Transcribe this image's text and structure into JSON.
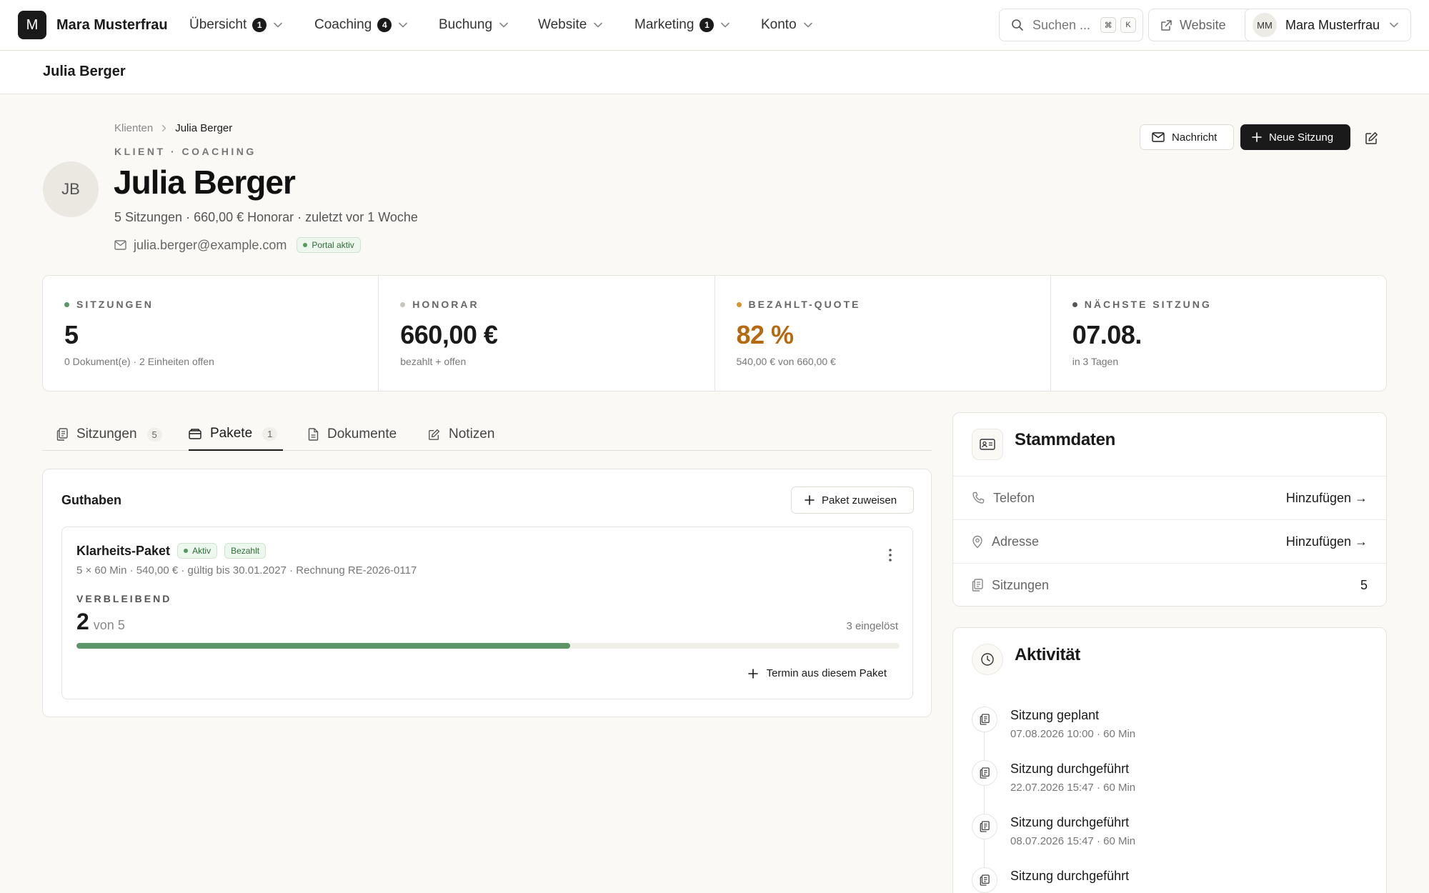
{
  "brand": {
    "logo_letter": "M",
    "name": "Mara Musterfrau"
  },
  "nav": [
    {
      "label": "Übersicht",
      "badge": "1"
    },
    {
      "label": "Coaching",
      "badge": "4"
    },
    {
      "label": "Buchung",
      "badge": ""
    },
    {
      "label": "Website",
      "badge": ""
    },
    {
      "label": "Marketing",
      "badge": "1"
    },
    {
      "label": "Konto",
      "badge": ""
    }
  ],
  "search": {
    "label": "Suchen ...",
    "kbd_mod": "⌘",
    "kbd_key": "K"
  },
  "website_button": "Website",
  "user": {
    "initials": "MM",
    "name": "Mara Musterfrau"
  },
  "subheader": {
    "title": "Julia Berger"
  },
  "breadcrumb": {
    "parent": "Klienten",
    "current": "Julia Berger"
  },
  "profile": {
    "eyebrow": "KLIENT · COACHING",
    "initials": "JB",
    "name": "Julia Berger",
    "summary": "5 Sitzungen · 660,00 € Honorar · zuletzt vor 1 Woche",
    "email": "julia.berger@example.com",
    "portal_badge": "Portal aktiv"
  },
  "actions": {
    "message": "Nachricht",
    "new_session": "Neue Sitzung"
  },
  "stats": [
    {
      "label": "SITZUNGEN",
      "value": "5",
      "sub": "0 Dokument(e) · 2 Einheiten offen",
      "dot_color": "#5b9466"
    },
    {
      "label": "HONORAR",
      "value": "660,00 €",
      "sub": "bezahlt + offen",
      "dot_color": "#c9c6bf"
    },
    {
      "label": "BEZAHLT-QUOTE",
      "value": "82 %",
      "sub": "540,00 € von 660,00 €",
      "dot_color": "#d8952f"
    },
    {
      "label": "NÄCHSTE SITZUNG",
      "value": "07.08.",
      "sub": "in 3 Tagen",
      "dot_color": "#555555"
    }
  ],
  "tabs": [
    {
      "label": "Sitzungen",
      "count": "5"
    },
    {
      "label": "Pakete",
      "count": "1"
    },
    {
      "label": "Dokumente",
      "count": ""
    },
    {
      "label": "Notizen",
      "count": ""
    }
  ],
  "credits": {
    "title": "Guthaben",
    "assign_button": "Paket zuweisen",
    "package": {
      "name": "Klarheits-Paket",
      "status": "Aktiv",
      "payment": "Bezahlt",
      "meta": "5 × 60 Min · 540,00 € · gültig bis 30.01.2027 · Rechnung RE-2026-0117",
      "remaining_label": "VERBLEIBEND",
      "remaining": "2",
      "total_text": "von 5",
      "redeemed": "3 eingelöst",
      "progress_fraction": 0.6,
      "action": "Termin aus diesem Paket"
    }
  },
  "stammdaten": {
    "title": "Stammdaten",
    "rows": [
      {
        "label": "Telefon",
        "value": "Hinzufügen →"
      },
      {
        "label": "Adresse",
        "value": "Hinzufügen →"
      },
      {
        "label": "Sitzungen",
        "value": "5"
      }
    ]
  },
  "activity": {
    "title": "Aktivität",
    "items": [
      {
        "title": "Sitzung geplant",
        "sub": "07.08.2026 10:00 · 60 Min"
      },
      {
        "title": "Sitzung durchgeführt",
        "sub": "22.07.2026 15:47 · 60 Min"
      },
      {
        "title": "Sitzung durchgeführt",
        "sub": "08.07.2026 15:47 · 60 Min"
      },
      {
        "title": "Sitzung durchgeführt",
        "sub": ""
      }
    ]
  },
  "colors": {
    "accent_dark": "#1a1a1a",
    "success": "#5b9466",
    "amber": "#b56a10",
    "background": "#faf9f6"
  }
}
